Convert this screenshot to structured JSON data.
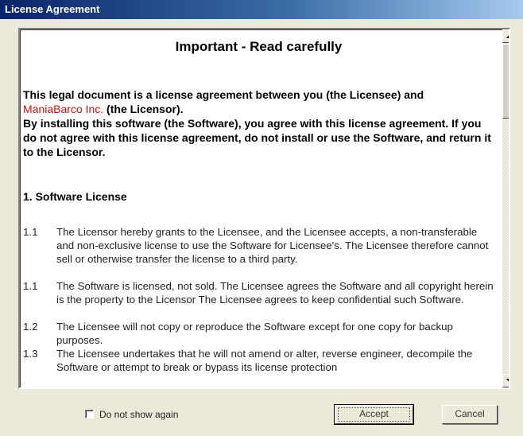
{
  "window": {
    "title": "License Agreement"
  },
  "document": {
    "title": "Important - Read carefully",
    "intro_1": "This legal document is a license agreement between you (the Licensee) and",
    "company": "ManiaBarco Inc.",
    "intro_2": " (the Licensor).",
    "intro_3": "By installing this software (the Software), you agree with this license agreement. If you do not agree with this license agreement, do not install or use the Software, and return it to the Licensor.",
    "section_heading": "1.  Software License",
    "clauses": [
      {
        "num": "1.1",
        "text": "The Licensor hereby grants to the Licensee, and the Licensee accepts, a non-transferable and non-exclusive license to use the Software for Licensee's. The Licensee therefore cannot sell or otherwise transfer the license to a third party."
      },
      {
        "num": "1.1",
        "text": "The Software is licensed, not sold. The Licensee agrees the Software and all copyright herein is the property to the Licensor The Licensee agrees to keep confidential such Software."
      },
      {
        "num": "1.2",
        "text": "The Licensee will not copy or reproduce the Software except for one copy for backup purposes."
      },
      {
        "num": "1.3",
        "text": "The Licensee undertakes that he will not amend or alter, reverse engineer, decompile the Software or attempt to break or bypass its license protection"
      }
    ]
  },
  "footer": {
    "checkbox_label": "Do not show again",
    "checkbox_checked": false,
    "accept_label": "Accept",
    "cancel_label": "Cancel"
  },
  "colors": {
    "titlebar_start": "#0a246a",
    "titlebar_end": "#a6caf0",
    "company_text": "#d01010",
    "dialog_bg": "#ece9d8"
  },
  "icons": [
    "scroll-up-arrow-icon",
    "scroll-down-arrow-icon"
  ]
}
